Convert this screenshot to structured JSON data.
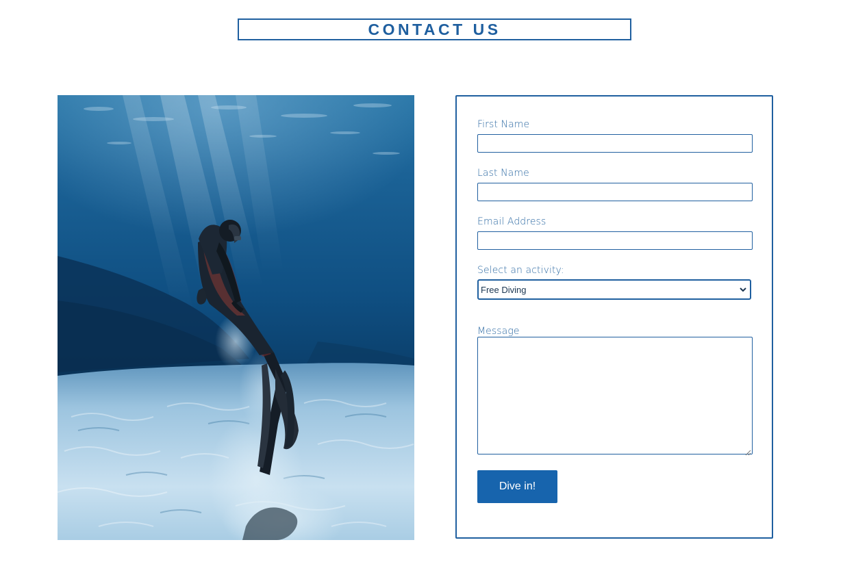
{
  "header": {
    "title": "CONTACT US"
  },
  "hero_image": {
    "icon": "freediver-underwater-photo"
  },
  "form": {
    "first_name": {
      "label": "First Name",
      "value": "",
      "placeholder": ""
    },
    "last_name": {
      "label": "Last Name",
      "value": "",
      "placeholder": ""
    },
    "email": {
      "label": "Email Address",
      "value": "",
      "placeholder": ""
    },
    "activity": {
      "label": "Select an activity:",
      "selected": "Free Diving"
    },
    "message": {
      "label": "Message",
      "value": ""
    },
    "submit_label": "Dive in!"
  },
  "colors": {
    "brand": "#1f5f9f",
    "button": "#1764ad",
    "label": "#2d6aa3",
    "background": "#ffffff"
  }
}
